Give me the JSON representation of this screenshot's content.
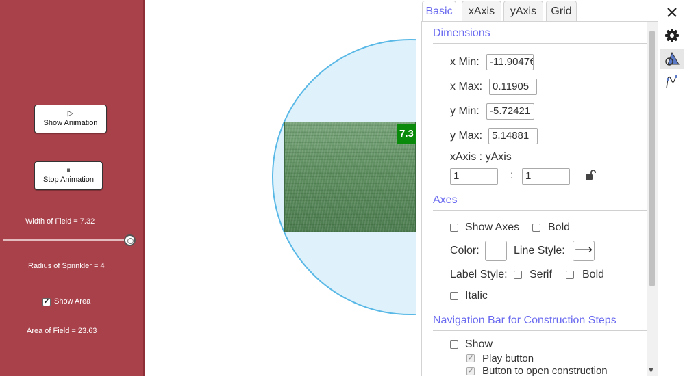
{
  "left_panel": {
    "show_animation_label": "Show Animation",
    "stop_animation_label": "Stop Animation",
    "width_text": "Width of Field = 7.32",
    "width_slider_value": 7.32,
    "radius_text": "Radius of Sprinkler = 4",
    "show_area_label": "Show Area",
    "show_area_checked": true,
    "area_text": "Area of Field = 23.63"
  },
  "graphics": {
    "field_label": "7.3"
  },
  "settings": {
    "tabs": [
      {
        "label": "Basic",
        "active": true
      },
      {
        "label": "xAxis",
        "active": false
      },
      {
        "label": "yAxis",
        "active": false
      },
      {
        "label": "Grid",
        "active": false
      }
    ],
    "dimensions": {
      "title": "Dimensions",
      "xmin_label": "x Min:",
      "xmin_value": "-11.9047€",
      "xmax_label": "x Max:",
      "xmax_value": "0.11905",
      "ymin_label": "y Min:",
      "ymin_value": "-5.72421",
      "ymax_label": "y Max:",
      "ymax_value": "5.14881",
      "ratio_label": "xAxis : yAxis",
      "ratio_x": "1",
      "ratio_sep": ":",
      "ratio_y": "1"
    },
    "axes": {
      "title": "Axes",
      "show_axes_label": "Show Axes",
      "bold_label": "Bold",
      "color_label": "Color:",
      "line_style_label": "Line Style:",
      "line_style_glyph": "⟶",
      "label_style_label": "Label Style:",
      "serif_label": "Serif",
      "label_bold_label": "Bold",
      "italic_label": "Italic"
    },
    "navigation": {
      "title": "Navigation Bar for Construction Steps",
      "show_label": "Show",
      "play_button_label": "Play button",
      "open_construction_label": "Button to open construction"
    }
  },
  "colors": {
    "left_panel_bg": "#a9414a",
    "sprinkler_fill": "#dff2fb",
    "sprinkler_stroke": "#59b8e6",
    "field_label_bg": "#0a8a0a",
    "accent": "#6a6af0"
  }
}
